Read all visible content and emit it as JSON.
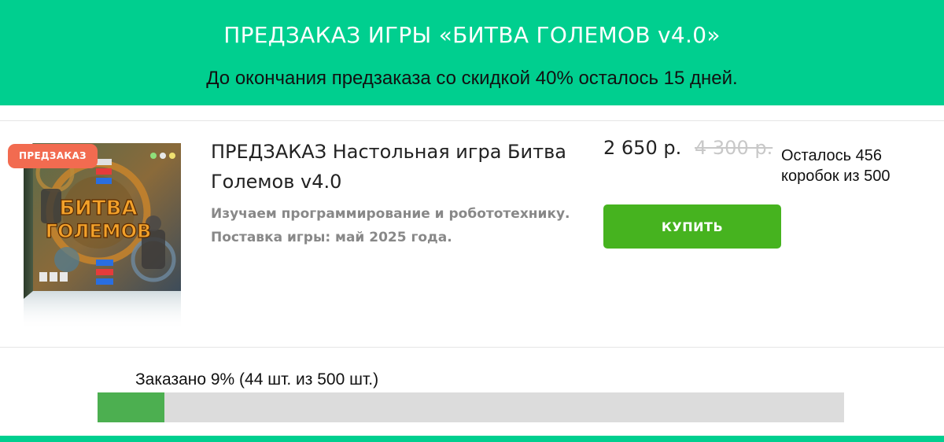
{
  "banner": {
    "title": "ПРЕДЗАКАЗ ИГРЫ «БИТВА ГОЛЕМОВ v4.0»",
    "subtitle": "До окончания предзаказа со скидкой 40% осталось 15 дней."
  },
  "product": {
    "badge": "ПРЕДЗАКАЗ",
    "title": "ПРЕДЗАКАЗ Настольная игра Битва Големов v4.0",
    "description": "Изучаем программирование и робототехнику. Поставка игры: май 2025 года.",
    "price_current": "2 650 р.",
    "price_old": "4 300 р.",
    "stock_line1": "Осталось 456",
    "stock_line2": "коробок из 500",
    "buy_label": "КУПИТЬ",
    "box_title_line1": "БИТВА",
    "box_title_line2": "ГОЛЕМОВ"
  },
  "progress": {
    "label": "Заказано 9% (44 шт. из 500 шт.)",
    "fraction": 0.09
  },
  "colors": {
    "accent": "#00cf8f",
    "buy": "#46b31f",
    "badge": "#f26b50",
    "progress_fill": "#4caf50"
  }
}
